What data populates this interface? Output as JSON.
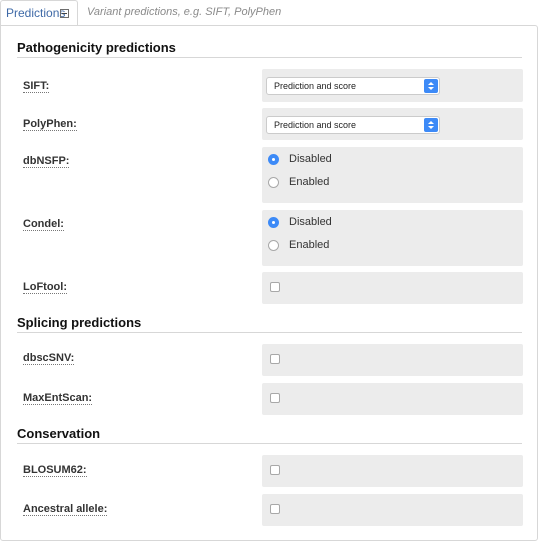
{
  "tab": {
    "label": "Predictions",
    "hint": "Variant predictions, e.g. SIFT, PolyPhen"
  },
  "sections": {
    "pathogenicity": "Pathogenicity predictions",
    "splicing": "Splicing predictions",
    "conservation": "Conservation"
  },
  "fields": {
    "sift": {
      "label": "SIFT:",
      "value": "Prediction and score"
    },
    "polyphen": {
      "label": "PolyPhen:",
      "value": "Prediction and score"
    },
    "dbnsfp": {
      "label": "dbNSFP:",
      "options": [
        "Disabled",
        "Enabled"
      ],
      "selected": "Disabled"
    },
    "condel": {
      "label": "Condel:",
      "options": [
        "Disabled",
        "Enabled"
      ],
      "selected": "Disabled"
    },
    "loftool": {
      "label": "LoFtool:",
      "checked": false
    },
    "dbscsnv": {
      "label": "dbscSNV:",
      "checked": false
    },
    "maxentscan": {
      "label": "MaxEntScan:",
      "checked": false
    },
    "blosum62": {
      "label": "BLOSUM62:",
      "checked": false
    },
    "ancestral": {
      "label": "Ancestral allele:",
      "checked": false
    }
  },
  "colors": {
    "tab_text": "#3f6aa7",
    "accent": "#3d8af7",
    "field_background": "#ececec"
  },
  "icons": [
    "collapse-toggle-icon",
    "select-arrow-icon"
  ]
}
